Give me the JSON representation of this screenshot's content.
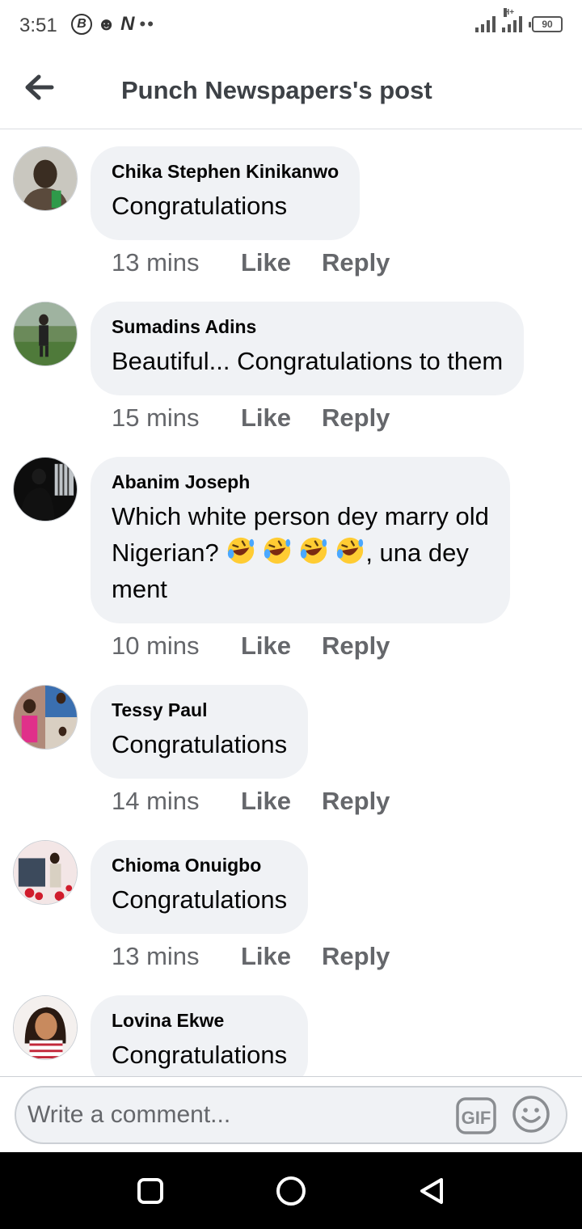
{
  "status_bar": {
    "time": "3:51",
    "battery": "90",
    "network_tag": "H+",
    "left_icons": [
      "b-circle-icon",
      "person-add-icon",
      "n-icon",
      "more-dots-icon"
    ]
  },
  "header": {
    "title": "Punch Newspapers's post",
    "back_icon": "arrow-left-icon"
  },
  "comments": [
    {
      "author": "Chika Stephen Kinikanwo",
      "text": "Congratulations",
      "time": "13 mins",
      "like": "Like",
      "reply": "Reply"
    },
    {
      "author": "Sumadins Adins",
      "text": "Beautiful... Congratulations to them",
      "time": "15 mins",
      "like": "Like",
      "reply": "Reply"
    },
    {
      "author": "Abanim Joseph",
      "text_line1": "Which white person dey marry old",
      "text_line2_before": "Nigerian?",
      "emojis": [
        "rolling-laughing-emoji",
        "rolling-laughing-emoji",
        "rolling-laughing-emoji",
        "rolling-laughing-emoji"
      ],
      "text_line2_after": ", una dey",
      "text_line3": "ment",
      "time": "10 mins",
      "like": "Like",
      "reply": "Reply"
    },
    {
      "author": "Tessy Paul",
      "text": "Congratulations",
      "time": "14 mins",
      "like": "Like",
      "reply": "Reply"
    },
    {
      "author": "Chioma Onuigbo",
      "text": "Congratulations",
      "time": "13 mins",
      "like": "Like",
      "reply": "Reply"
    },
    {
      "author": "Lovina Ekwe",
      "text": "Congratulations"
    }
  ],
  "composer": {
    "placeholder": "Write a comment...",
    "gif_label": "GIF",
    "emoji_icon": "smiley-face-icon"
  },
  "nav_bar": {
    "icons": [
      "recents-square-icon",
      "home-circle-icon",
      "back-triangle-icon"
    ]
  },
  "colors": {
    "bubble": "#f0f2f5",
    "meta_text": "#65676b",
    "title_text": "#3d4146",
    "nav_bg": "#000000"
  }
}
